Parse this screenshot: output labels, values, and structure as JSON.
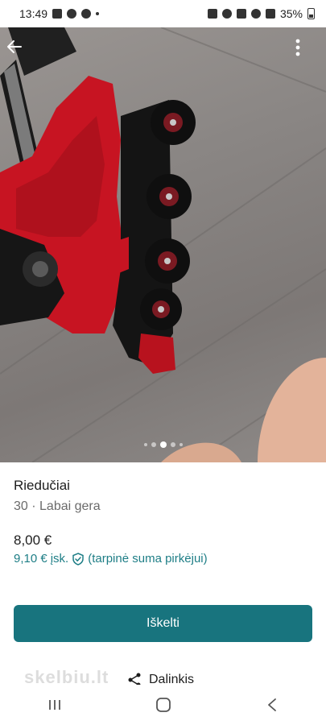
{
  "status_bar": {
    "time": "13:49",
    "battery": "35%",
    "left_icons": [
      "gallery-icon",
      "threads-icon",
      "facebook-icon",
      "dot-icon"
    ],
    "right_icons": [
      "alarm-icon",
      "bluetooth-icon",
      "mute-icon",
      "wifi-icon",
      "signal-icon",
      "battery-icon"
    ]
  },
  "hero": {
    "back_icon": "arrow-left-icon",
    "more_icon": "more-vertical-icon",
    "carousel": {
      "count": 5,
      "active_index": 2
    }
  },
  "listing": {
    "title": "Riedučiai",
    "subtitle": "30 · Labai gera",
    "price": "8,00 €",
    "price_incl": "9,10 €",
    "price_incl_suffix": "įsk.",
    "buyer_protection": "(tarpinė suma pirkėjui)"
  },
  "actions": {
    "primary_label": "Iškelti",
    "share_label": "Dalinkis",
    "watermark": "skelbiu.lt"
  },
  "colors": {
    "accent": "#18747e",
    "accent_text": "#1e7e86"
  },
  "nav": {
    "icons": [
      "recents-icon",
      "home-icon",
      "back-icon"
    ]
  }
}
